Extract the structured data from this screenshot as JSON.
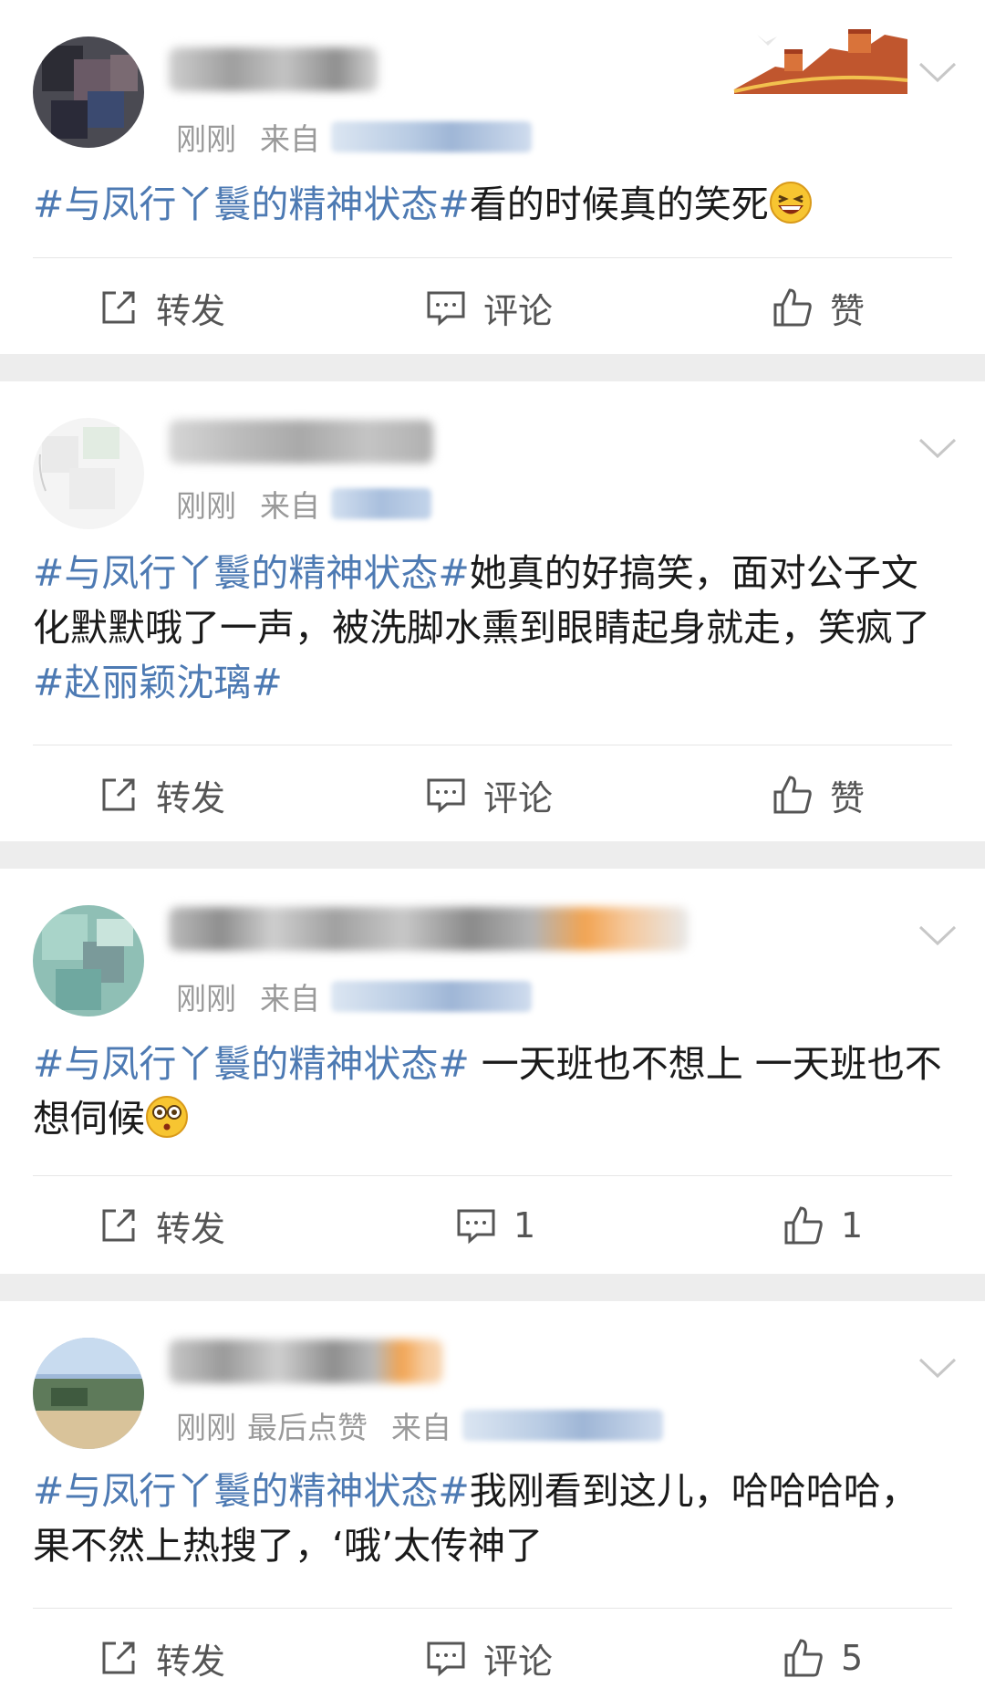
{
  "colors": {
    "topic": "#4d7ab3",
    "text": "#1a1a1a",
    "meta": "#9a9a9a",
    "action": "#555555",
    "background": "#ededed"
  },
  "actions": {
    "repost_label": "转发",
    "comment_label": "评论",
    "like_label": "赞",
    "repost_icon": "repost-icon",
    "comment_icon": "comment-icon",
    "like_icon": "thumbs-up-icon",
    "more_icon": "chevron-down-icon"
  },
  "posts": [
    {
      "time": "刚刚",
      "liked_note": "",
      "from": "来自",
      "topic": "#与凤行丫鬟的精神状态#",
      "text": "看的时候真的笑死",
      "emoji": "laughing-emoji",
      "comments": "评论",
      "likes": "赞"
    },
    {
      "time": "刚刚",
      "liked_note": "",
      "from": "来自",
      "topic": "#与凤行丫鬟的精神状态#",
      "text": "她真的好搞笑，面对公子文化默默哦了一声，被洗脚水熏到眼睛起身就走，笑疯了",
      "topic2": "#赵丽颖沈璃#",
      "comments": "评论",
      "likes": "赞"
    },
    {
      "time": "刚刚",
      "liked_note": "",
      "from": "来自",
      "topic": "#与凤行丫鬟的精神状态#",
      "text": " 一天班也不想上 一天班也不想伺候",
      "emoji": "flushed-emoji",
      "comments": "1",
      "likes": "1"
    },
    {
      "time": "刚刚",
      "liked_note": "最后点赞",
      "from": "来自",
      "topic": "#与凤行丫鬟的精神状态#",
      "text": "我刚看到这儿，哈哈哈哈，果不然上热搜了，‘哦’太传神了",
      "comments": "评论",
      "likes": "5"
    }
  ]
}
